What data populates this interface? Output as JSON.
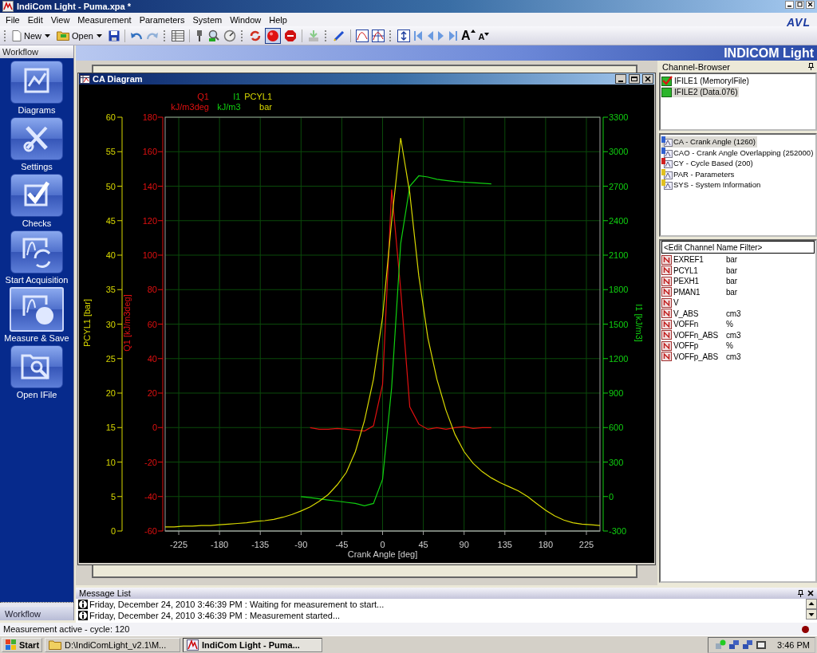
{
  "window": {
    "title": "IndiCom Light - Puma.xpa *",
    "logo": "AVL"
  },
  "menu": [
    "File",
    "Edit",
    "View",
    "Measurement",
    "Parameters",
    "System",
    "Window",
    "Help"
  ],
  "toolbar": {
    "new_label": "New",
    "open_label": "Open",
    "record_pressed": true,
    "font_larger": "A",
    "font_smaller": "A"
  },
  "workflow": {
    "title": "Workflow",
    "footer_tab": "Workflow",
    "items": [
      {
        "label": "Diagrams",
        "selected": false
      },
      {
        "label": "Settings",
        "selected": false
      },
      {
        "label": "Checks",
        "selected": false
      },
      {
        "label": "Start Acquisition",
        "selected": false
      },
      {
        "label": "Measure & Save",
        "selected": true
      },
      {
        "label": "Open IFile",
        "selected": false
      }
    ]
  },
  "banner": "INDICOM Light",
  "diagram": {
    "title": "CA Diagram",
    "legend_units": [
      "kJ/m3deg",
      "kJ/m3",
      "bar"
    ],
    "chart_data": {
      "type": "line",
      "xlabel": "Crank Angle [deg]",
      "ylabel": "PCYL1 [bar]",
      "y2label": "I1 [kJ/m3]",
      "y3label": "Q1 [kJ/m3deg]",
      "grid": true,
      "xlim": [
        -240,
        240
      ],
      "ylim": [
        0,
        60
      ],
      "y2lim": [
        -300,
        3300
      ],
      "y3lim": [
        -60,
        180
      ],
      "xticks": [
        -225,
        -180,
        -135,
        -90,
        -45,
        0,
        45,
        90,
        135,
        180,
        225
      ],
      "yticks": [
        0,
        5,
        10,
        15,
        20,
        25,
        30,
        35,
        40,
        45,
        50,
        55,
        60
      ],
      "y2ticks": [
        -300,
        0,
        300,
        600,
        900,
        1200,
        1500,
        1800,
        2100,
        2400,
        2700,
        3000,
        3300
      ],
      "y3ticks": [
        -60,
        -40,
        -20,
        0,
        20,
        40,
        60,
        80,
        100,
        120,
        140,
        160,
        180
      ],
      "x": [
        -240,
        -230,
        -220,
        -210,
        -200,
        -190,
        -180,
        -170,
        -160,
        -150,
        -140,
        -130,
        -120,
        -110,
        -100,
        -90,
        -80,
        -70,
        -60,
        -50,
        -40,
        -30,
        -20,
        -10,
        0,
        10,
        20,
        30,
        40,
        50,
        60,
        70,
        80,
        90,
        100,
        110,
        120,
        130,
        140,
        150,
        160,
        170,
        180,
        190,
        200,
        210,
        220,
        230,
        240
      ],
      "series": [
        {
          "name": "Q1",
          "color": "#e01010",
          "axis": "y3",
          "values": [
            null,
            null,
            null,
            null,
            null,
            null,
            null,
            null,
            null,
            null,
            null,
            null,
            null,
            null,
            null,
            null,
            0,
            -1,
            -1,
            -0.5,
            -1,
            -1.5,
            -2,
            1,
            25,
            138,
            80,
            12,
            2,
            -1,
            0,
            -1,
            0,
            0.5,
            -0.5,
            0,
            0,
            null,
            null,
            null,
            null,
            null,
            null,
            null,
            null,
            null,
            null,
            null,
            null
          ]
        },
        {
          "name": "I1",
          "color": "#10d010",
          "axis": "y2",
          "values": [
            null,
            null,
            null,
            null,
            null,
            null,
            null,
            null,
            null,
            null,
            null,
            null,
            null,
            null,
            null,
            0,
            -10,
            -20,
            -30,
            -40,
            -50,
            -60,
            -80,
            -60,
            150,
            950,
            2200,
            2700,
            2790,
            2780,
            2760,
            2750,
            2740,
            2735,
            2730,
            2725,
            2720,
            null,
            null,
            null,
            null,
            null,
            null,
            null,
            null,
            null,
            null,
            null,
            null
          ]
        },
        {
          "name": "PCYL1",
          "color": "#d8d800",
          "values": [
            0.6,
            0.6,
            0.7,
            0.7,
            0.8,
            0.8,
            0.9,
            1.0,
            1.1,
            1.2,
            1.4,
            1.5,
            1.7,
            2.0,
            2.4,
            2.9,
            3.5,
            4.3,
            5.3,
            6.7,
            8.5,
            11.5,
            16,
            22,
            31,
            45,
            57,
            49,
            37,
            28,
            22,
            17.5,
            14,
            11.5,
            9.8,
            8.6,
            7.7,
            7.0,
            6.4,
            5.8,
            5.0,
            4.0,
            3.0,
            2.2,
            1.6,
            1.2,
            1.0,
            0.9,
            0.8
          ]
        }
      ]
    }
  },
  "channel_browser": {
    "title": "Channel-Browser",
    "files": [
      {
        "label": "IFILE1 (MemoryIFile)",
        "checked": true,
        "selected": false
      },
      {
        "label": "IFILE2 (Data.076)",
        "checked": false,
        "selected": true
      }
    ],
    "groups": [
      {
        "label": "CA - Crank Angle (1260)",
        "color": "#3060d0",
        "selected": true
      },
      {
        "label": "CAO - Crank Angle Overlapping (252000)",
        "color": "#3060d0",
        "selected": false
      },
      {
        "label": "CY - Cycle Based (200)",
        "color": "#d02020",
        "selected": false
      },
      {
        "label": "PAR - Parameters",
        "color": "#e0c020",
        "selected": false
      },
      {
        "label": "SYS - System Information",
        "color": "#e0c020",
        "selected": false
      }
    ],
    "filter": {
      "placeholder": "<Edit Channel Name Filter>"
    },
    "channels": [
      {
        "name": "EXREF1",
        "unit": "bar"
      },
      {
        "name": "PCYL1",
        "unit": "bar"
      },
      {
        "name": "PEXH1",
        "unit": "bar"
      },
      {
        "name": "PMAN1",
        "unit": "bar"
      },
      {
        "name": "V"
      },
      {
        "name": "V_ABS",
        "unit": "cm3"
      },
      {
        "name": "VOFFn",
        "unit": "%"
      },
      {
        "name": "VOFFn_ABS",
        "unit": "cm3"
      },
      {
        "name": "VOFFp",
        "unit": "%"
      },
      {
        "name": "VOFFp_ABS",
        "unit": "cm3"
      }
    ]
  },
  "messages": {
    "title": "Message List",
    "items": [
      "Friday, December 24, 2010 3:46:39 PM : Waiting for measurement to start...",
      "Friday, December 24, 2010 3:46:39 PM : Measurement started..."
    ]
  },
  "status_bar": {
    "text": "Measurement active - cycle: 120",
    "recording": true
  },
  "taskbar": {
    "start": "Start",
    "tasks": [
      {
        "label": "D:\\IndiComLight_v2.1\\M...",
        "selected": false
      },
      {
        "label": "IndiCom Light - Puma...",
        "selected": true
      }
    ],
    "clock": "3:46 PM"
  }
}
